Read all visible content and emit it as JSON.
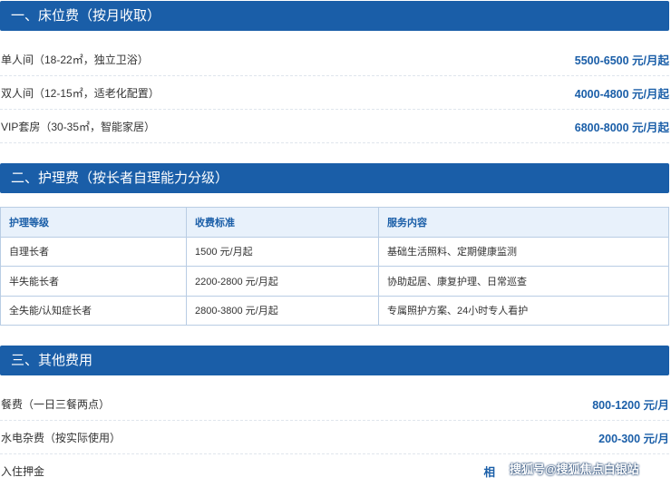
{
  "sections": {
    "bed": {
      "title": "一、床位费（按月收取）",
      "items": [
        {
          "label": "单人间（18-22㎡，独立卫浴）",
          "price": "5500-6500 元/月起"
        },
        {
          "label": "双人间（12-15㎡，适老化配置）",
          "price": "4000-4800 元/月起"
        },
        {
          "label": "VIP套房（30-35㎡，智能家居）",
          "price": "6800-8000 元/月起"
        }
      ]
    },
    "care": {
      "title": "二、护理费（按长者自理能力分级）",
      "headers": [
        "护理等级",
        "收费标准",
        "服务内容"
      ],
      "rows": [
        [
          "自理长者",
          "1500 元/月起",
          "基础生活照料、定期健康监测"
        ],
        [
          "半失能长者",
          "2200-2800 元/月起",
          "协助起居、康复护理、日常巡查"
        ],
        [
          "全失能/认知症长者",
          "2800-3800 元/月起",
          "专属照护方案、24小时专人看护"
        ]
      ]
    },
    "other": {
      "title": "三、其他费用",
      "items": [
        {
          "label": "餐费（一日三餐两点）",
          "price": "800-1200 元/月"
        },
        {
          "label": "水电杂费（按实际使用）",
          "price": "200-300 元/月"
        },
        {
          "label": "入住押金",
          "price": "相"
        }
      ]
    }
  },
  "watermark": "搜狐号@搜狐焦点白银站"
}
